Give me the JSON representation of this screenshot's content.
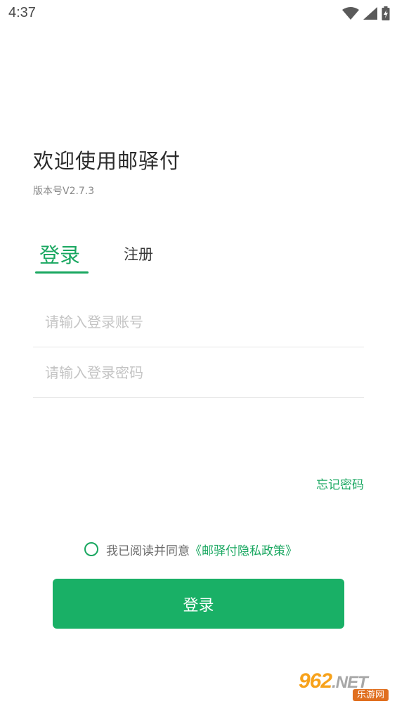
{
  "status_bar": {
    "time": "4:37",
    "icons": [
      "wifi-icon",
      "signal-icon",
      "battery-charging-icon"
    ]
  },
  "header": {
    "title": "欢迎使用邮驿付",
    "version": "版本号V2.7.3"
  },
  "tabs": [
    {
      "label": "登录",
      "active": true
    },
    {
      "label": "注册",
      "active": false
    }
  ],
  "form": {
    "account": {
      "placeholder": "请输入登录账号",
      "value": ""
    },
    "password": {
      "placeholder": "请输入登录密码",
      "value": ""
    },
    "forgot_password": "忘记密码"
  },
  "agreement": {
    "checked": false,
    "text": "我已阅读并同意",
    "link": "《邮驿付隐私政策》"
  },
  "login_button": "登录",
  "watermark": {
    "brand_digits": "962",
    "brand_suffix": ".NET",
    "sub": "乐游网"
  },
  "colors": {
    "accent": "#19a760",
    "button": "#19b066",
    "placeholder": "#c4c4c4",
    "divider": "#e6e6e6"
  }
}
